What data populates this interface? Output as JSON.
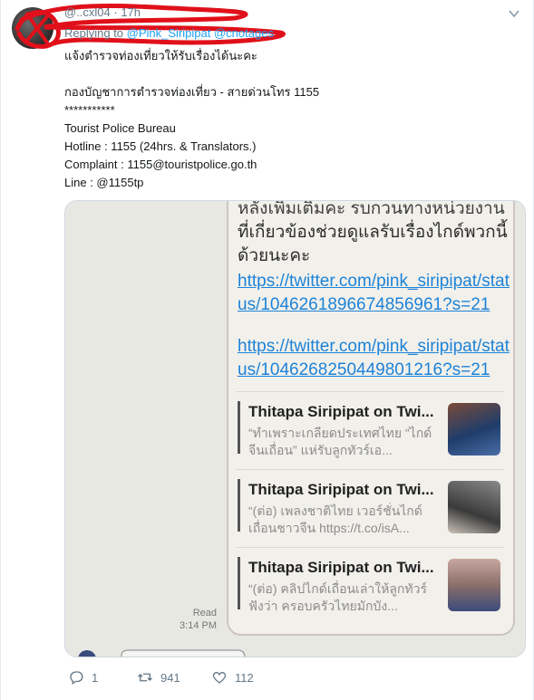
{
  "tweet": {
    "handle_row": "@..cxl04 · 17h",
    "reply_prefix": "Replying to",
    "reply_mentions": "@Pink_Siripipat @cnotages",
    "body": "แจ้งตำรวจท่องเที่ยวให้รับเรื่องได้นะคะ\n\nกองบัญชาการตำรวจท่องเที่ยว - สายด่วนโทร 1155\n***********\nTourist Police Bureau\nHotline : 1155 (24hrs. & Translators.)\nComplaint : 1155@touristpolice.go.th\nLine : @1155tp"
  },
  "media": {
    "chat_text_cut": "หลังเพิ่มเติมคะ รบกวนทางหน่วยงาน",
    "chat_text": "ที่เกี่ยวข้องช่วยดูแลรับเรื่องไกด์พวกนี้ด้วยนะคะ",
    "link1": "https://twitter.com/pink_siripipat/status/1046261896674856961?s=21",
    "link2": "https://twitter.com/pink_siripipat/status/1046268250449801216?s=21",
    "cards": [
      {
        "title": "Thitapa Siripipat on Twi...",
        "snippet": "“ทำเพราะเกลียดประเทศไทย “ไกด์จีนเถื่อน” แห่รับลูกทัวร์เอ..."
      },
      {
        "title": "Thitapa Siripipat on Twi...",
        "snippet": "“(ต่อ) เพลงชาติไทย เวอร์ชั่นไกด์เถื่อนชาวจีน https://t.co/isA..."
      },
      {
        "title": "Thitapa Siripipat on Twi...",
        "snippet": "“(ต่อ) คลิปไกด์เถื่อนเล่าให้ลูกทัวร์ฟังว่า ครอบครัวไทยมักบัง..."
      }
    ],
    "read_label": "Read",
    "read_time": "3:14 PM"
  },
  "actions": {
    "replies": "1",
    "retweets": "941",
    "likes": "112"
  },
  "colors": {
    "accent": "#1da1f2",
    "link": "#1d83d8",
    "scribble": "#e0101a"
  }
}
